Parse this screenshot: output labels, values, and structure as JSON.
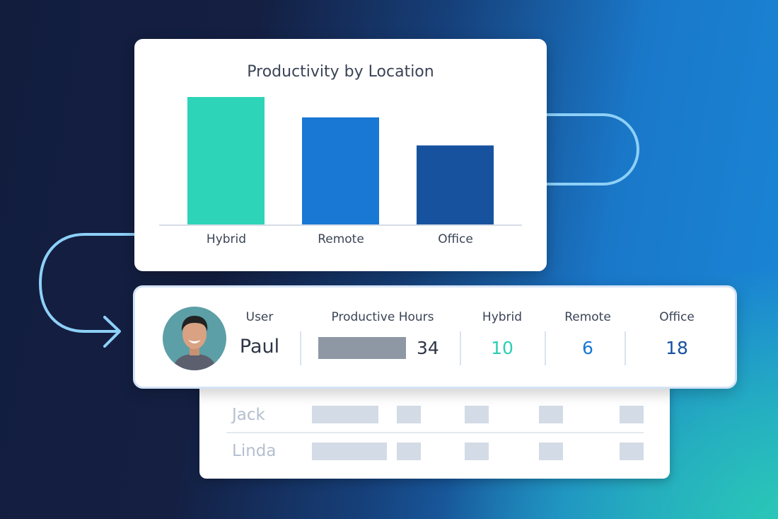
{
  "chart_data": {
    "type": "bar",
    "title": "Productivity by Location",
    "categories": [
      "Hybrid",
      "Remote",
      "Office"
    ],
    "values": [
      100,
      84,
      62
    ],
    "colors": [
      "#2dd4b7",
      "#1878d4",
      "#17529f"
    ],
    "ylim": [
      0,
      100
    ],
    "xlabel": "",
    "ylabel": "",
    "grid": false,
    "legend": "none"
  },
  "user_row": {
    "headers": {
      "user": "User",
      "hours": "Productive Hours",
      "hybrid": "Hybrid",
      "remote": "Remote",
      "office": "Office"
    },
    "name": "Paul",
    "hours": "34",
    "hybrid": "10",
    "remote": "6",
    "office": "18",
    "colors": {
      "hybrid": "#2ccfb3",
      "remote": "#1877d3",
      "office": "#16509f"
    }
  },
  "other_rows": [
    {
      "name": "Jack"
    },
    {
      "name": "Linda"
    }
  ],
  "icons": {
    "avatar": "user-photo",
    "arrow": "arrow-right-icon"
  }
}
